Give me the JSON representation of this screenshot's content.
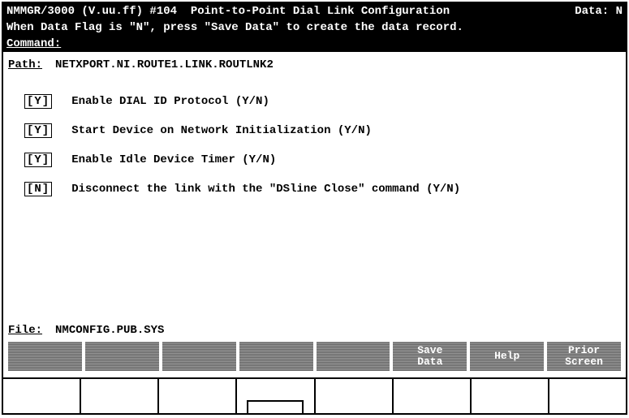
{
  "header": {
    "title_left": "NMMGR/3000 (V.uu.ff) #104  Point-to-Point Dial Link Configuration",
    "title_right": "Data: N",
    "info": "When Data Flag is \"N\", press \"Save Data\" to create the data record.",
    "command_label": "Command:"
  },
  "path": {
    "label": "Path:",
    "value": "NETXPORT.NI.ROUTE1.LINK.ROUTLNK2"
  },
  "fields": [
    {
      "value": "[Y]",
      "label": "Enable DIAL ID Protocol (Y/N)"
    },
    {
      "value": "[Y]",
      "label": "Start Device on Network Initialization (Y/N)"
    },
    {
      "value": "[Y]",
      "label": "Enable Idle Device Timer (Y/N)"
    },
    {
      "value": "[N]",
      "label": "Disconnect the link with the \"DSline Close\" command (Y/N)"
    }
  ],
  "file": {
    "label": "File:",
    "value": "NMCONFIG.PUB.SYS"
  },
  "fkeys": [
    {
      "line1": "",
      "line2": ""
    },
    {
      "line1": "",
      "line2": ""
    },
    {
      "line1": "",
      "line2": ""
    },
    {
      "line1": "",
      "line2": ""
    },
    {
      "line1": "",
      "line2": ""
    },
    {
      "line1": "Save",
      "line2": "Data"
    },
    {
      "line1": "Help",
      "line2": ""
    },
    {
      "line1": "Prior",
      "line2": "Screen"
    }
  ]
}
